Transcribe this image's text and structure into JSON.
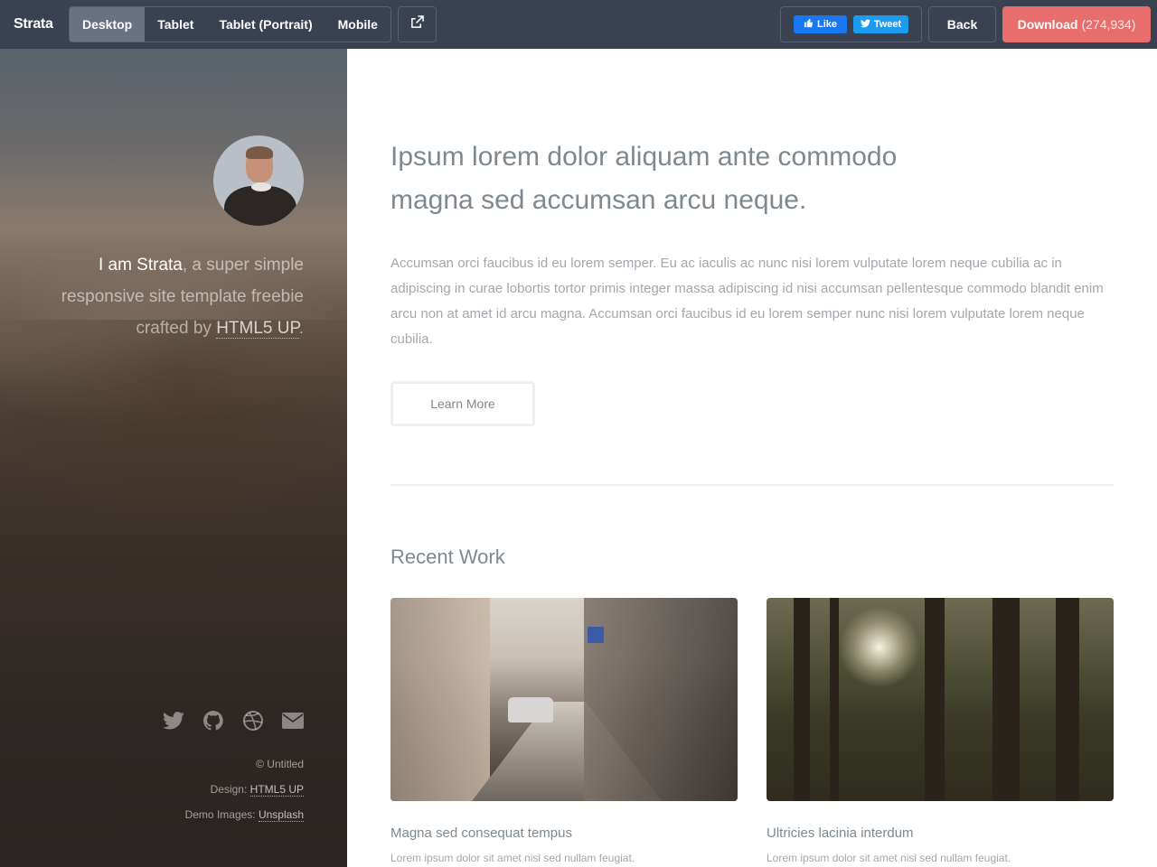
{
  "topbar": {
    "brand": "Strata",
    "devices": [
      "Desktop",
      "Tablet",
      "Tablet (Portrait)",
      "Mobile"
    ],
    "active_device": "Desktop",
    "fb_like": "Like",
    "tweet": "Tweet",
    "back": "Back",
    "download": "Download",
    "download_count": "(274,934)",
    "download_color": "#e76e6c"
  },
  "sidebar": {
    "intro_strong": "I am Strata",
    "intro_text": ", a super simple responsive site template freebie crafted by ",
    "intro_link": "HTML5 UP",
    "intro_end": ".",
    "social_icons": [
      "twitter-icon",
      "github-icon",
      "dribbble-icon",
      "envelope-icon"
    ],
    "copyright": "© Untitled",
    "design_label": "Design: ",
    "design_link": "HTML5 UP",
    "images_label": "Demo Images: ",
    "images_link": "Unsplash"
  },
  "main": {
    "headline_line1": "Ipsum lorem dolor aliquam ante commodo",
    "headline_line2": "magna sed accumsan arcu neque.",
    "paragraph": "Accumsan orci faucibus id eu lorem semper. Eu ac iaculis ac nunc nisi lorem vulputate lorem neque cubilia ac in adipiscing in curae lobortis tortor primis integer massa adipiscing id nisi accumsan pellentesque commodo blandit enim arcu non at amet id arcu magna. Accumsan orci faucibus id eu lorem semper nunc nisi lorem vulputate lorem neque cubilia.",
    "learn_more": "Learn More",
    "section_title": "Recent Work",
    "works": [
      {
        "title": "Magna sed consequat tempus",
        "desc": "Lorem ipsum dolor sit amet nisl sed nullam feugiat."
      },
      {
        "title": "Ultricies lacinia interdum",
        "desc": "Lorem ipsum dolor sit amet nisl sed nullam feugiat."
      }
    ]
  }
}
